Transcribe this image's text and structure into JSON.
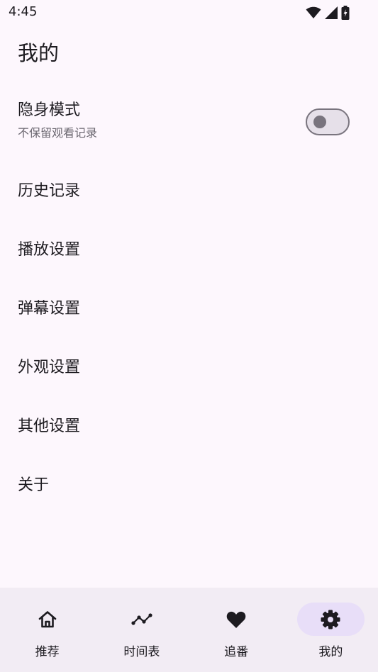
{
  "status_bar": {
    "time": "4:45"
  },
  "page": {
    "title": "我的"
  },
  "incognito": {
    "title": "隐身模式",
    "subtitle": "不保留观看记录",
    "enabled": false
  },
  "menu": {
    "items": [
      {
        "label": "历史记录"
      },
      {
        "label": "播放设置"
      },
      {
        "label": "弹幕设置"
      },
      {
        "label": "外观设置"
      },
      {
        "label": "其他设置"
      },
      {
        "label": "关于"
      }
    ]
  },
  "bottom_nav": {
    "items": [
      {
        "label": "推荐",
        "icon": "home-icon"
      },
      {
        "label": "时间表",
        "icon": "timeline-icon"
      },
      {
        "label": "追番",
        "icon": "heart-icon"
      },
      {
        "label": "我的",
        "icon": "gear-icon",
        "active": true
      }
    ]
  },
  "colors": {
    "background": "#fdf7fd",
    "nav_background": "#f2ecf4",
    "active_pill": "#e8def8",
    "text": "#1d1b20",
    "secondary_text": "#6b6770",
    "toggle_outline": "#79747e"
  }
}
